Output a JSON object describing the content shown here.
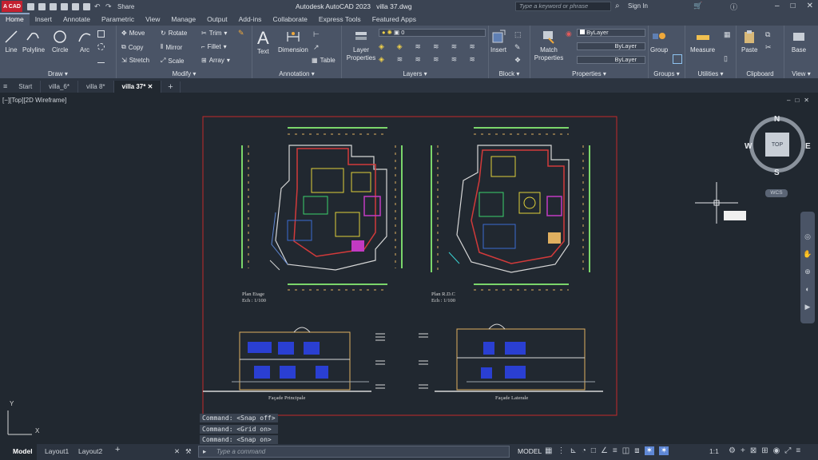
{
  "titlebar": {
    "logo": "A CAD",
    "share": "Share",
    "app_title": "Autodesk AutoCAD 2023",
    "file_title": "villa 37.dwg",
    "search_placeholder": "Type a keyword or phrase",
    "signin": "Sign In"
  },
  "ribbon_tabs": [
    "Home",
    "Insert",
    "Annotate",
    "Parametric",
    "View",
    "Manage",
    "Output",
    "Add-ins",
    "Collaborate",
    "Express Tools",
    "Featured Apps"
  ],
  "ribbon": {
    "draw": {
      "label": "Draw",
      "line": "Line",
      "polyline": "Polyline",
      "circle": "Circle",
      "arc": "Arc"
    },
    "modify": {
      "label": "Modify",
      "move": "Move",
      "rotate": "Rotate",
      "trim": "Trim",
      "copy": "Copy",
      "mirror": "Mirror",
      "fillet": "Fillet",
      "stretch": "Stretch",
      "scale": "Scale",
      "array": "Array"
    },
    "annotation": {
      "label": "Annotation",
      "text": "Text",
      "dimension": "Dimension",
      "table": "Table"
    },
    "layers": {
      "label": "Layers",
      "layer_properties": "Layer Properties",
      "current_layer": "0"
    },
    "block": {
      "label": "Block",
      "insert": "Insert"
    },
    "properties": {
      "label": "Properties",
      "match": "Match Properties",
      "bylayer1": "ByLayer",
      "bylayer2": "ByLayer",
      "bylayer3": "ByLayer"
    },
    "groups": {
      "label": "Groups",
      "group": "Group"
    },
    "utilities": {
      "label": "Utilities",
      "measure": "Measure"
    },
    "clipboard": {
      "label": "Clipboard",
      "paste": "Paste"
    },
    "view": {
      "label": "View",
      "base": "Base"
    }
  },
  "file_tabs": [
    "Start",
    "villa_6*",
    "villa 8*",
    "villa 37*"
  ],
  "viewport_label": "[−][Top][2D Wireframe]",
  "viewcube": {
    "n": "N",
    "s": "S",
    "e": "E",
    "w": "W",
    "top": "TOP",
    "wcs": "WCS"
  },
  "drawing": {
    "plan1_title": "Plan Etage",
    "plan1_scale": "Ech : 1/100",
    "plan2_title": "Plan R.D.C",
    "plan2_scale": "Ech : 1/100",
    "facade1": "Façade Principale",
    "facade2": "Façade Laterale"
  },
  "command_history": [
    "Command: <Snap off>",
    "Command: <Grid on>",
    "Command: <Snap on>"
  ],
  "command_placeholder": "Type a command",
  "status": {
    "model_tab": "Model",
    "layout1": "Layout1",
    "layout2": "Layout2",
    "model_label": "MODEL",
    "scale": "1:1"
  },
  "colors": {
    "accent": "#c42130",
    "background": "#212830"
  }
}
